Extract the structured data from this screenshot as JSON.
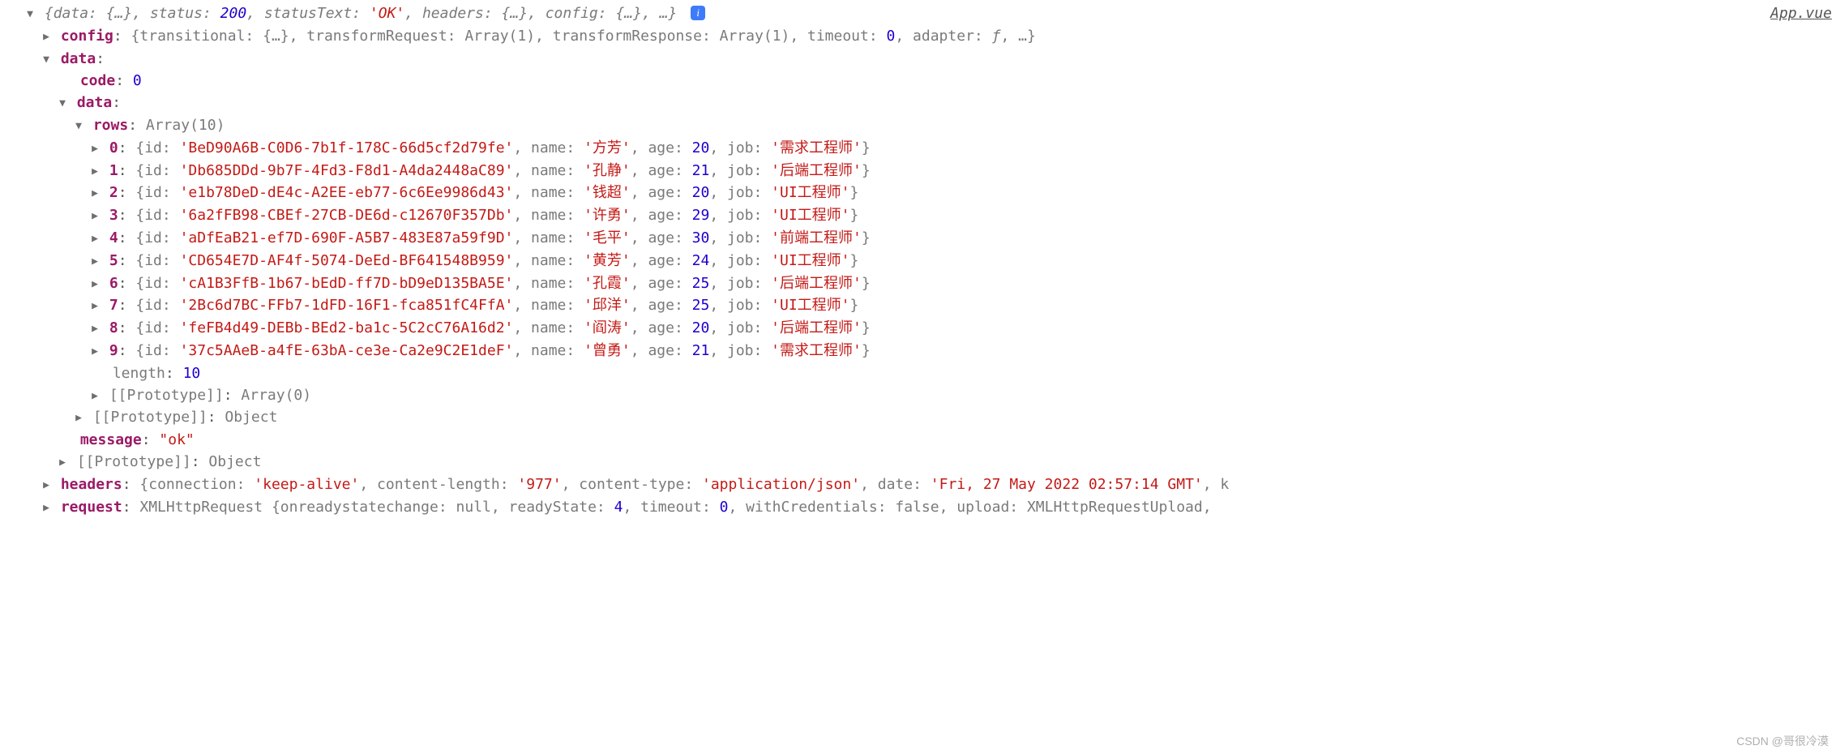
{
  "file_link": "App.vue",
  "summary": {
    "data_label": "data",
    "status_label": "status",
    "status_value": 200,
    "statusText_label": "statusText",
    "statusText_value": "'OK'",
    "headers_label": "headers",
    "config_label": "config",
    "ellipsis": "{…}",
    "trailing": ", …"
  },
  "config_line": {
    "key": "config",
    "preview": " {transitional: {…}, transformRequest: Array(1), transformResponse: Array(1), timeout: ",
    "timeout": 0,
    "adapter": ", adapter: ",
    "adapter_val": "ƒ",
    "tail": ", …}"
  },
  "data_outer_key": "data",
  "code_key": "code",
  "code_value": 0,
  "data_inner_key": "data",
  "rows_key": "rows",
  "rows_preview": " Array(10)",
  "rows": [
    {
      "idx": "0",
      "id": "'BeD90A6B-C0D6-7b1f-178C-66d5cf2d79fe'",
      "name": "'方芳'",
      "age": 20,
      "job": "'需求工程师'"
    },
    {
      "idx": "1",
      "id": "'Db685DDd-9b7F-4Fd3-F8d1-A4da2448aC89'",
      "name": "'孔静'",
      "age": 21,
      "job": "'后端工程师'"
    },
    {
      "idx": "2",
      "id": "'e1b78DeD-dE4c-A2EE-eb77-6c6Ee9986d43'",
      "name": "'钱超'",
      "age": 20,
      "job": "'UI工程师'"
    },
    {
      "idx": "3",
      "id": "'6a2fFB98-CBEf-27CB-DE6d-c12670F357Db'",
      "name": "'许勇'",
      "age": 29,
      "job": "'UI工程师'"
    },
    {
      "idx": "4",
      "id": "'aDfEaB21-ef7D-690F-A5B7-483E87a59f9D'",
      "name": "'毛平'",
      "age": 30,
      "job": "'前端工程师'"
    },
    {
      "idx": "5",
      "id": "'CD654E7D-AF4f-5074-DeEd-BF641548B959'",
      "name": "'黄芳'",
      "age": 24,
      "job": "'UI工程师'"
    },
    {
      "idx": "6",
      "id": "'cA1B3FfB-1b67-bEdD-ff7D-bD9eD135BA5E'",
      "name": "'孔霞'",
      "age": 25,
      "job": "'后端工程师'"
    },
    {
      "idx": "7",
      "id": "'2Bc6d7BC-FFb7-1dFD-16F1-fca851fC4FfA'",
      "name": "'邱洋'",
      "age": 25,
      "job": "'UI工程师'"
    },
    {
      "idx": "8",
      "id": "'feFB4d49-DEBb-BEd2-ba1c-5C2cC76A16d2'",
      "name": "'阎涛'",
      "age": 20,
      "job": "'后端工程师'"
    },
    {
      "idx": "9",
      "id": "'37c5AAeB-a4fE-63bA-ce3e-Ca2e9C2E1deF'",
      "name": "'曾勇'",
      "age": 21,
      "job": "'需求工程师'"
    }
  ],
  "length_key": "length",
  "length_value": 10,
  "proto_label": "[[Prototype]]",
  "proto_array": " Array(0)",
  "proto_object": " Object",
  "message_key": "message",
  "message_value": "\"ok\"",
  "headers_line": {
    "key": "headers",
    "pairs": [
      {
        "k": "connection",
        "v": "'keep-alive'"
      },
      {
        "k": "content-length",
        "v": "'977'"
      },
      {
        "k": "content-type",
        "v": "'application/json'"
      },
      {
        "k": "date",
        "v": "'Fri, 27 May 2022 02:57:14 GMT'"
      }
    ],
    "tail": ", k"
  },
  "request_line": {
    "key": "request",
    "text": " XMLHttpRequest {onreadystatechange: ",
    "null_val": "null",
    "rest1": ", readyState: ",
    "readyState": 4,
    "rest2": ", timeout: ",
    "timeout": 0,
    "rest3": ", withCredentials: ",
    "withCredentials": "false",
    "rest4": ", upload: XMLHttpRequestUpload,"
  },
  "row_field_labels": {
    "id": "id",
    "name": "name",
    "age": "age",
    "job": "job"
  },
  "watermark": "CSDN @哥很冷漠"
}
